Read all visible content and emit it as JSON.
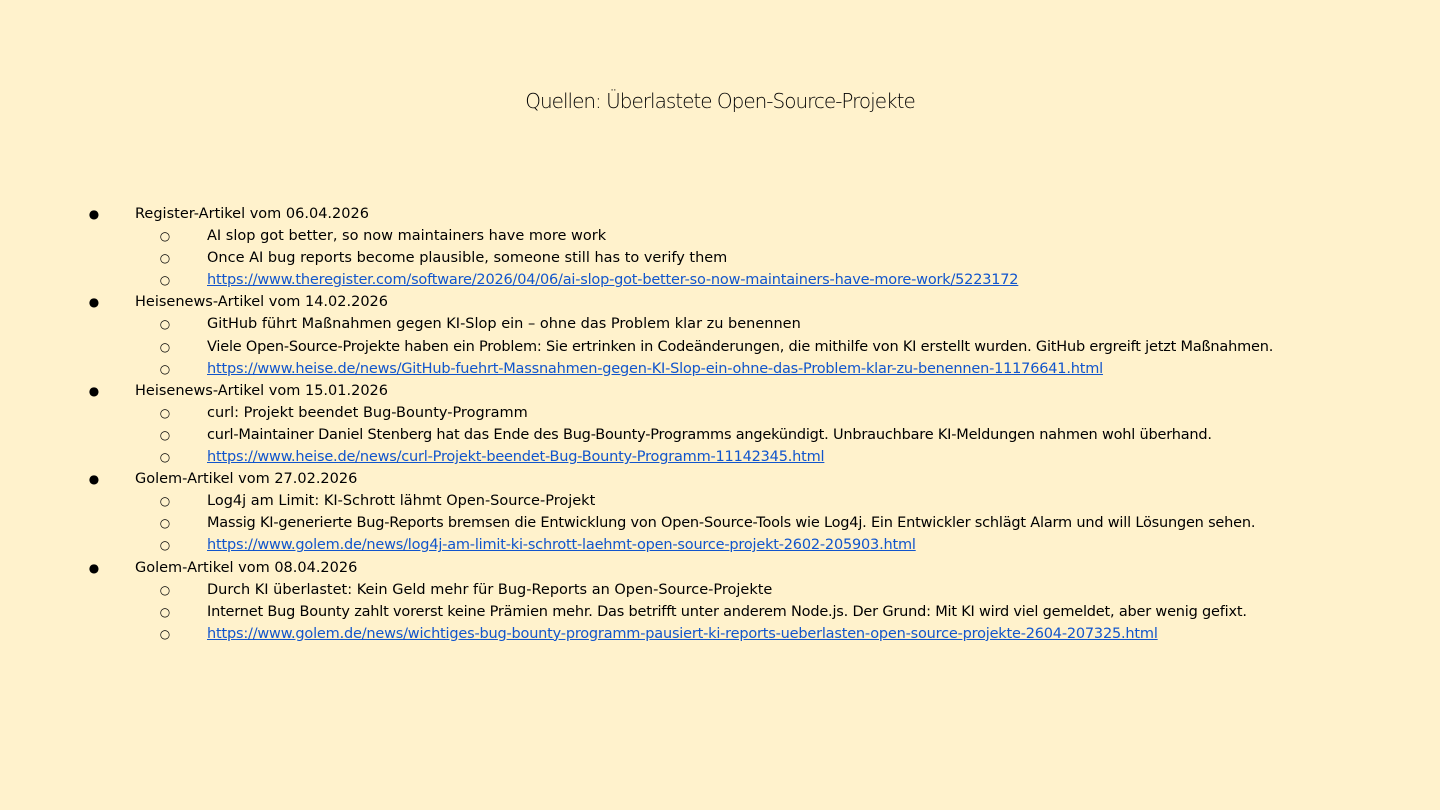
{
  "slide": {
    "title": "Quellen: Überlastete Open-Source-Projekte",
    "bullet_level1": "●",
    "bullet_level2": "○",
    "link_color": "#1155cc",
    "background_color": "#fff2cc"
  },
  "sources": [
    {
      "heading": "Register-Artikel vom 06.04.2026",
      "headline": "AI slop got better, so now maintainers have more work",
      "summary": "Once AI bug reports become plausible, someone still has to verify them",
      "url": "https://www.theregister.com/software/2026/04/06/ai-slop-got-better-so-now-maintainers-have-more-work/5223172"
    },
    {
      "heading": "Heisenews-Artikel vom 14.02.2026",
      "headline": "GitHub führt Maßnahmen gegen KI-Slop ein – ohne das Problem klar zu benennen",
      "summary": "Viele Open-Source-Projekte haben ein Problem: Sie ertrinken in Codeänderungen, die mithilfe von KI erstellt wurden. GitHub ergreift jetzt Maßnahmen.",
      "url": "https://www.heise.de/news/GitHub-fuehrt-Massnahmen-gegen-KI-Slop-ein-ohne-das-Problem-klar-zu-benennen-11176641.html"
    },
    {
      "heading": "Heisenews-Artikel vom 15.01.2026",
      "headline": "curl: Projekt beendet Bug-Bounty-Programm",
      "summary": "curl-Maintainer Daniel Stenberg hat das Ende des Bug-Bounty-Programms angekündigt. Unbrauchbare KI-Meldungen nahmen wohl überhand.",
      "url": "https://www.heise.de/news/curl-Projekt-beendet-Bug-Bounty-Programm-11142345.html"
    },
    {
      "heading": "Golem-Artikel vom 27.02.2026",
      "headline": "Log4j am Limit: KI-Schrott lähmt Open-Source-Projekt",
      "summary": "Massig KI-generierte Bug-Reports bremsen die Entwicklung von Open-Source-Tools wie Log4j. Ein Entwickler schlägt Alarm und will Lösungen sehen.",
      "url": "https://www.golem.de/news/log4j-am-limit-ki-schrott-laehmt-open-source-projekt-2602-205903.html"
    },
    {
      "heading": "Golem-Artikel vom 08.04.2026",
      "headline": "Durch KI überlastet: Kein Geld mehr für Bug-Reports an Open-Source-Projekte",
      "summary": "Internet Bug Bounty zahlt vorerst keine Prämien mehr. Das betrifft unter anderem Node.js. Der Grund: Mit KI wird viel gemeldet, aber wenig gefixt.",
      "url": "https://www.golem.de/news/wichtiges-bug-bounty-programm-pausiert-ki-reports-ueberlasten-open-source-projekte-2604-207325.html"
    }
  ]
}
